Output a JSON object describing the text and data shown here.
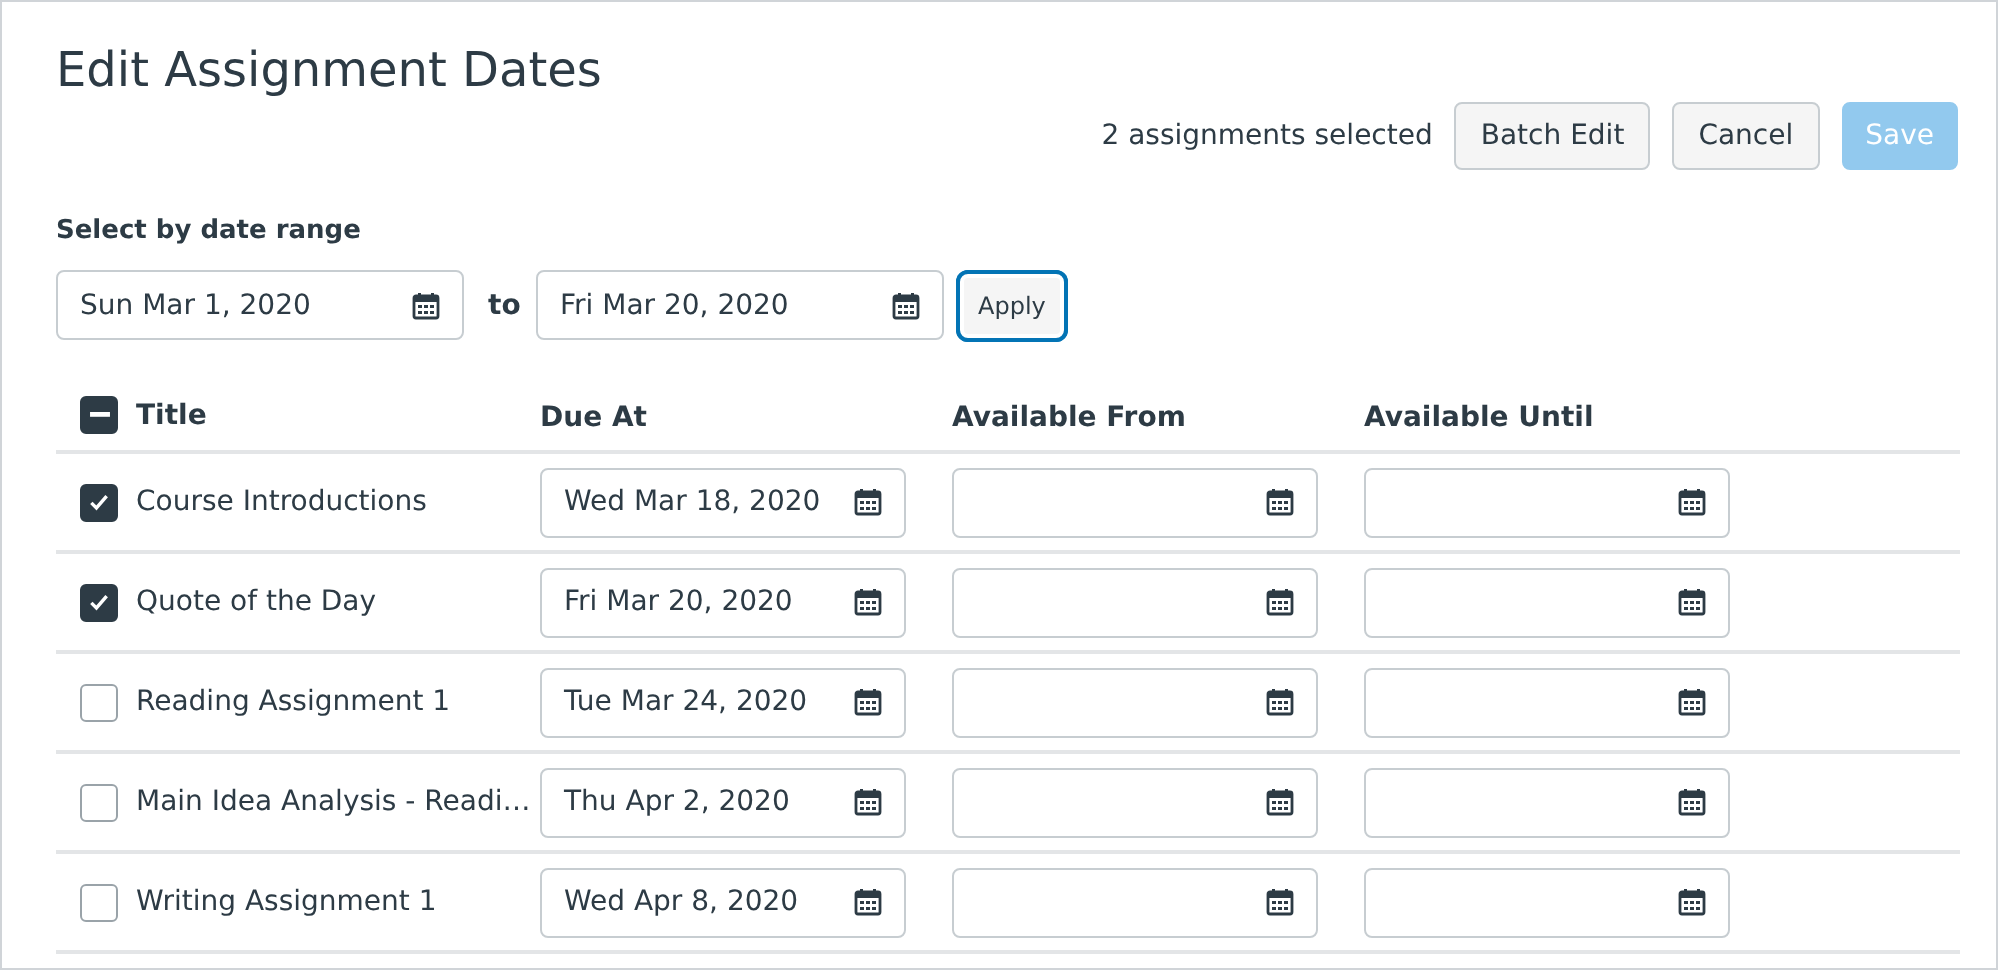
{
  "title": "Edit Assignment Dates",
  "selection_count": "2 assignments selected",
  "buttons": [
    {
      "label": "Batch Edit",
      "kind": "plain",
      "disabled": false
    },
    {
      "label": "Cancel",
      "kind": "plain",
      "disabled": false
    },
    {
      "label": "Save",
      "kind": "primary",
      "disabled": true
    }
  ],
  "date_range": {
    "label": "Select by date range",
    "from": "Sun Mar 1, 2020",
    "to_label": "to",
    "to": "Fri Mar 20, 2020",
    "apply": {
      "label": "Apply",
      "focused": true
    }
  },
  "table": {
    "select_all_indeterminate": true,
    "columns": [
      "Title",
      "Due At",
      "Available From",
      "Available Until"
    ],
    "rows": [
      {
        "title": "Course Introductions",
        "checked": true,
        "due_at": "Wed Mar 18, 2020"
      },
      {
        "title": "Quote of the Day",
        "checked": true,
        "due_at": "Fri Mar 20, 2020"
      },
      {
        "title": "Reading Assignment 1",
        "checked": false,
        "due_at": "Tue Mar 24, 2020"
      },
      {
        "title": "Main Idea Analysis - Readi…",
        "checked": false,
        "due_at": "Thu Apr 2, 2020"
      },
      {
        "title": "Writing Assignment 1",
        "checked": false,
        "due_at": "Wed Apr 8, 2020"
      }
    ]
  }
}
